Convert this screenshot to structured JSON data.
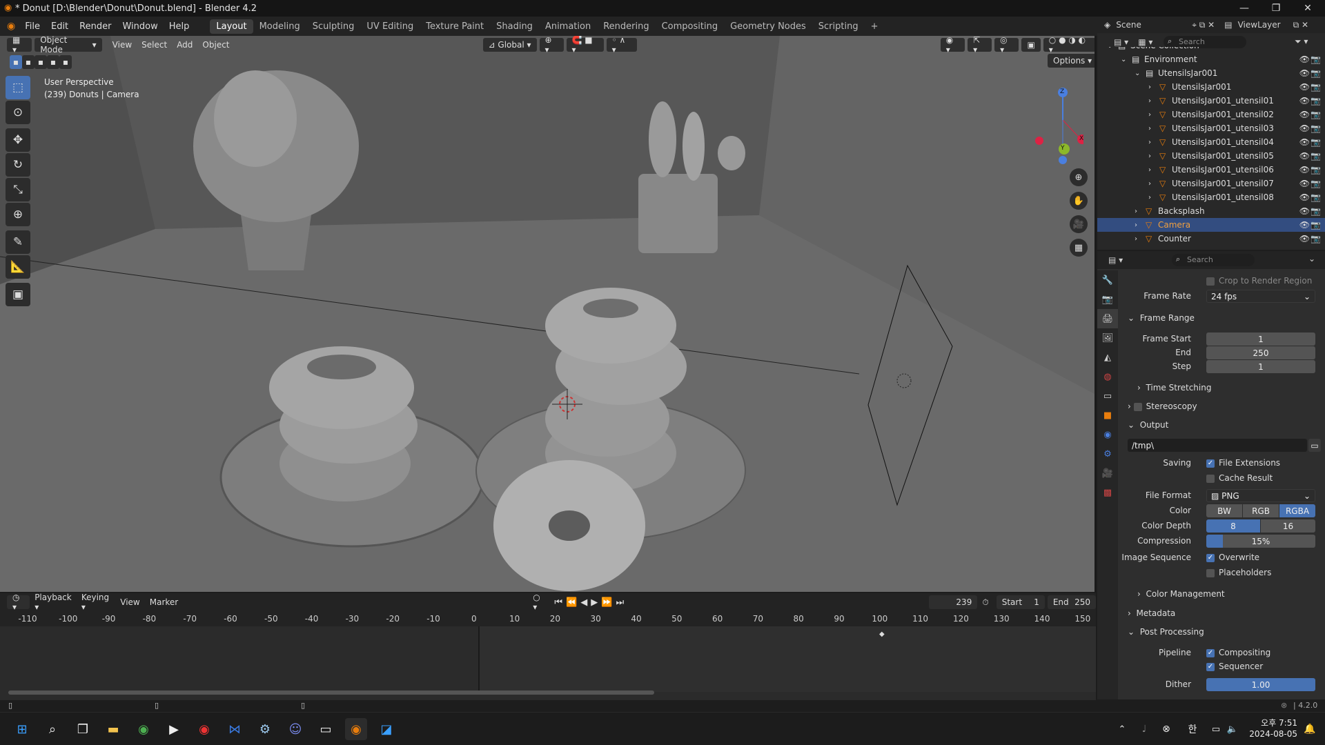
{
  "window": {
    "title": "* Donut [D:\\Blender\\Donut\\Donut.blend] - Blender 4.2",
    "min": "—",
    "max": "❐",
    "close": "✕"
  },
  "menu": [
    "File",
    "Edit",
    "Render",
    "Window",
    "Help"
  ],
  "workspaces": [
    "Layout",
    "Modeling",
    "Sculpting",
    "UV Editing",
    "Texture Paint",
    "Shading",
    "Animation",
    "Rendering",
    "Compositing",
    "Geometry Nodes",
    "Scripting"
  ],
  "workspace_add": "+",
  "topright": {
    "scene": "Scene",
    "viewlayer": "ViewLayer"
  },
  "viewport": {
    "mode": "Object Mode",
    "menus": [
      "View",
      "Select",
      "Add",
      "Object"
    ],
    "orientation": "Global",
    "options": "Options",
    "overlay_line1": "User Perspective",
    "overlay_line2": "(239) Donuts | Camera",
    "gizmo": {
      "z": "Z",
      "y": "Y",
      "x": "X"
    }
  },
  "outliner": {
    "search_placeholder": "Search",
    "rows": [
      {
        "label": "Scene Collection",
        "indent": 0,
        "sel": false
      },
      {
        "label": "Environment",
        "indent": 1,
        "sel": false
      },
      {
        "label": "UtensilsJar001",
        "indent": 2,
        "sel": false
      },
      {
        "label": "UtensilsJar001",
        "indent": 3,
        "sel": false
      },
      {
        "label": "UtensilsJar001_utensil01",
        "indent": 3,
        "sel": false
      },
      {
        "label": "UtensilsJar001_utensil02",
        "indent": 3,
        "sel": false
      },
      {
        "label": "UtensilsJar001_utensil03",
        "indent": 3,
        "sel": false
      },
      {
        "label": "UtensilsJar001_utensil04",
        "indent": 3,
        "sel": false
      },
      {
        "label": "UtensilsJar001_utensil05",
        "indent": 3,
        "sel": false
      },
      {
        "label": "UtensilsJar001_utensil06",
        "indent": 3,
        "sel": false
      },
      {
        "label": "UtensilsJar001_utensil07",
        "indent": 3,
        "sel": false
      },
      {
        "label": "UtensilsJar001_utensil08",
        "indent": 3,
        "sel": false
      },
      {
        "label": "Backsplash",
        "indent": 2,
        "sel": false
      },
      {
        "label": "Camera",
        "indent": 2,
        "sel": true
      },
      {
        "label": "Counter",
        "indent": 2,
        "sel": false
      }
    ]
  },
  "properties": {
    "search_placeholder": "Search",
    "crop": "Crop to Render Region",
    "frame_rate_label": "Frame Rate",
    "frame_rate_value": "24 fps",
    "frame_range": "Frame Range",
    "frame_start_label": "Frame Start",
    "frame_start": "1",
    "end_label": "End",
    "end": "250",
    "step_label": "Step",
    "step": "1",
    "time_stretching": "Time Stretching",
    "stereoscopy": "Stereoscopy",
    "output": "Output",
    "path": "/tmp\\",
    "saving_label": "Saving",
    "file_extensions": "File Extensions",
    "cache_result": "Cache Result",
    "file_format_label": "File Format",
    "file_format": "PNG",
    "color_label": "Color",
    "color_bw": "BW",
    "color_rgb": "RGB",
    "color_rgba": "RGBA",
    "color_depth_label": "Color Depth",
    "depth_8": "8",
    "depth_16": "16",
    "compression_label": "Compression",
    "compression": "15%",
    "compression_fraction": 0.15,
    "image_sequence_label": "Image Sequence",
    "overwrite": "Overwrite",
    "placeholders": "Placeholders",
    "color_management": "Color Management",
    "metadata": "Metadata",
    "post_processing": "Post Processing",
    "pipeline_label": "Pipeline",
    "compositing": "Compositing",
    "sequencer": "Sequencer",
    "dither_label": "Dither",
    "dither": "1.00"
  },
  "timeline": {
    "menus": [
      "Playback",
      "Keying",
      "View",
      "Marker"
    ],
    "current": "239",
    "start_label": "Start",
    "start": "1",
    "end_label": "End",
    "end": "250",
    "ticks": [
      "-110",
      "-100",
      "-90",
      "-80",
      "-70",
      "-60",
      "-50",
      "-40",
      "-30",
      "-20",
      "-10",
      "0",
      "10",
      "20",
      "30",
      "40",
      "50",
      "60",
      "70",
      "80",
      "90",
      "100",
      "110",
      "120",
      "130",
      "140",
      "150"
    ]
  },
  "status": {
    "version": "4.2.0"
  },
  "taskbar": {
    "time": "오후 7:51",
    "date": "2024-08-05",
    "ime": "한"
  }
}
